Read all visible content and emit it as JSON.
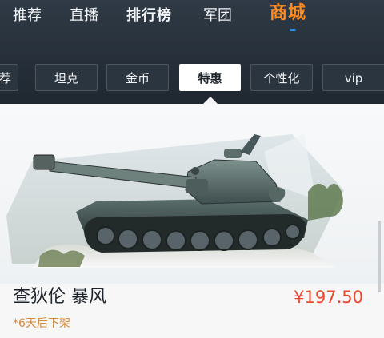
{
  "nav": {
    "items": [
      {
        "label": "推荐"
      },
      {
        "label": "直播"
      },
      {
        "label": "排行榜"
      },
      {
        "label": "军团"
      },
      {
        "label": "商城"
      }
    ]
  },
  "tabs": [
    {
      "label": "荐"
    },
    {
      "label": "坦克"
    },
    {
      "label": "金币"
    },
    {
      "label": "特惠"
    },
    {
      "label": "个性化"
    },
    {
      "label": "vip"
    }
  ],
  "product": {
    "name": "查狄伦 暴风",
    "price": "¥197.50",
    "note": "*6天后下架"
  },
  "colors": {
    "active_nav": "#ff8a1f",
    "indicator": "#1e8fff",
    "price": "#f0462c",
    "note": "#d58a3c"
  }
}
